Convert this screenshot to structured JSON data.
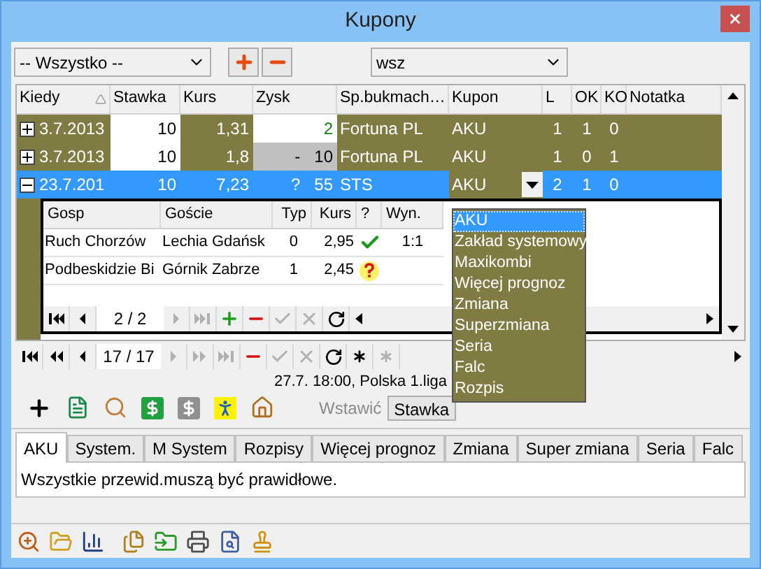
{
  "window": {
    "title": "Kupony"
  },
  "toolbar": {
    "filter_combo": "-- Wszystko --",
    "type_combo": "wsz"
  },
  "grid": {
    "columns": [
      {
        "label": "Kiedy",
        "sorted": true
      },
      {
        "label": "Stawka",
        "sorted": false
      },
      {
        "label": "Kurs",
        "sorted": false
      },
      {
        "label": "Zysk",
        "sorted": false
      },
      {
        "label": "Sp.bukmach…",
        "sorted": false
      },
      {
        "label": "Kupon",
        "sorted": false
      },
      {
        "label": "L",
        "sorted": false
      },
      {
        "label": "OK",
        "sorted": false
      },
      {
        "label": "KO",
        "sorted": false
      },
      {
        "label": "Notatka",
        "sorted": false
      }
    ],
    "rows": [
      {
        "kiedy": "3.7.2013",
        "stawka": "10",
        "kurs": "1,31",
        "zysk_sign": "",
        "zysk": "2",
        "kind": "won",
        "bookmaker": "Fortuna PL",
        "kupon": "AKU",
        "l": "1",
        "ok": "1",
        "ko": "0",
        "expanded": false,
        "selected": false,
        "editing": false
      },
      {
        "kiedy": "3.7.2013",
        "stawka": "10",
        "kurs": "1,8",
        "zysk_sign": "-",
        "zysk": "10",
        "kind": "lost",
        "bookmaker": "Fortuna PL",
        "kupon": "AKU",
        "l": "1",
        "ok": "0",
        "ko": "1",
        "expanded": false,
        "selected": false,
        "editing": false
      },
      {
        "kiedy": "23.7.201",
        "stawka": "10",
        "kurs": "7,23",
        "zysk_sign": "?",
        "zysk": "55",
        "kind": "open",
        "bookmaker": "STS",
        "kupon": "AKU",
        "l": "2",
        "ok": "1",
        "ko": "0",
        "expanded": true,
        "selected": true,
        "editing": true
      }
    ]
  },
  "detail": {
    "columns": [
      "Gosp",
      "Goście",
      "Typ",
      "Kurs",
      "?",
      "Wyn."
    ],
    "rows": [
      {
        "gosp": "Ruch Chorzów",
        "goscie": "Lechia Gdańsk",
        "typ": "0",
        "kurs": "2,95",
        "kind": "won",
        "wyn": "1:1"
      },
      {
        "gosp": "Podbeskidzie Bi",
        "goscie": "Górnik Zabrze",
        "typ": "1",
        "kurs": "2,45",
        "kind": "unknown",
        "wyn": ""
      }
    ],
    "navigator": {
      "position": "2 / 2",
      "buttons": [
        {
          "kind": "first",
          "disabled": false
        },
        {
          "kind": "prev",
          "disabled": false
        },
        {
          "kind": "pos"
        },
        {
          "kind": "next",
          "disabled": true
        },
        {
          "kind": "last",
          "disabled": true
        },
        {
          "kind": "add",
          "disabled": false
        },
        {
          "kind": "delete",
          "disabled": false
        },
        {
          "kind": "post",
          "disabled": true
        },
        {
          "kind": "cancel",
          "disabled": true
        },
        {
          "kind": "refresh",
          "disabled": false
        }
      ]
    }
  },
  "navigator": {
    "position": "17 / 17",
    "buttons": [
      {
        "kind": "first",
        "disabled": false
      },
      {
        "kind": "prior_page",
        "disabled": false
      },
      {
        "kind": "prev",
        "disabled": false
      },
      {
        "kind": "pos"
      },
      {
        "kind": "next",
        "disabled": true
      },
      {
        "kind": "next_page",
        "disabled": true
      },
      {
        "kind": "last",
        "disabled": true
      },
      {
        "kind": "delete",
        "disabled": false
      },
      {
        "kind": "post",
        "disabled": true
      },
      {
        "kind": "cancel",
        "disabled": true
      },
      {
        "kind": "refresh",
        "disabled": false
      },
      {
        "kind": "star",
        "disabled": false
      },
      {
        "kind": "star_arrow",
        "disabled": true
      }
    ]
  },
  "kupon_dropdown": {
    "options": [
      {
        "label": "AKU",
        "selected": true
      },
      {
        "label": "Zakład systemowy",
        "selected": false
      },
      {
        "label": "Maxikombi",
        "selected": false
      },
      {
        "label": "Więcej prognoz",
        "selected": false
      },
      {
        "label": "Zmiana",
        "selected": false
      },
      {
        "label": "Superzmiana",
        "selected": false
      },
      {
        "label": "Seria",
        "selected": false
      },
      {
        "label": "Falc",
        "selected": false
      },
      {
        "label": "Rozpis",
        "selected": false
      }
    ]
  },
  "status": "27.7. 18:00, Polska 1.liga",
  "insert": {
    "label": "Wstawić",
    "button": "Stawka"
  },
  "tabs": [
    {
      "label": "AKU",
      "selected": true
    },
    {
      "label": "System.",
      "selected": false
    },
    {
      "label": "M System",
      "selected": false
    },
    {
      "label": "Rozpisy",
      "selected": false
    },
    {
      "label": "Więcej prognoz",
      "selected": false
    },
    {
      "label": "Zmiana",
      "selected": false
    },
    {
      "label": "Super zmiana",
      "selected": false
    },
    {
      "label": "Seria",
      "selected": false
    },
    {
      "label": "Falc",
      "selected": false
    }
  ],
  "tab_content": "Wszystkie przewid.muszą być prawidłowe."
}
